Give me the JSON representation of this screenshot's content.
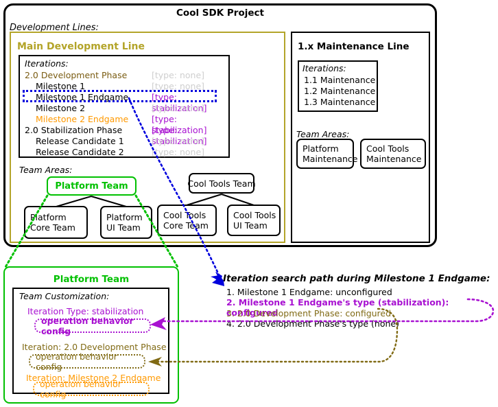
{
  "project": {
    "title": "Cool SDK Project",
    "dev_lines_label": "Development Lines:"
  },
  "main_dev_line": {
    "title": "Main Development Line",
    "iterations_label": "Iterations:",
    "iterations": [
      {
        "name": "2.0 Development Phase",
        "type": "[type: none]",
        "indent": 0,
        "name_color": "#7a5c12",
        "type_color": "#cfcfcf"
      },
      {
        "name": "Milestone 1",
        "type": "[type: none]",
        "indent": 1,
        "name_color": "#000000",
        "type_color": "#cfcfcf"
      },
      {
        "name": "Milestone 1 Endgame",
        "type": "[type: stabilization]",
        "indent": 1,
        "name_color": "#000000",
        "type_color": "#a811d1"
      },
      {
        "name": "Milestone 2",
        "type": "[type: none]",
        "indent": 1,
        "name_color": "#000000",
        "type_color": "#cfcfcf"
      },
      {
        "name": "Milestone 2 Endgame",
        "type": "[type: stabilization]",
        "indent": 1,
        "name_color": "#ff9900",
        "type_color": "#a811d1"
      },
      {
        "name": "2.0 Stabilization Phase",
        "type": "[type: stabilization]",
        "indent": 0,
        "name_color": "#000000",
        "type_color": "#a811d1"
      },
      {
        "name": "Release Candidate 1",
        "type": "[type: none]",
        "indent": 1,
        "name_color": "#000000",
        "type_color": "#cfcfcf"
      },
      {
        "name": "Release Candidate 2",
        "type": "[type: none]",
        "indent": 1,
        "name_color": "#000000",
        "type_color": "#cfcfcf"
      }
    ],
    "team_areas_label": "Team Areas:",
    "teams": {
      "platform_team": "Platform Team",
      "platform_core_team": "Platform\nCore Team",
      "platform_ui_team": "Platform\nUI Team",
      "cool_tools_team": "Cool Tools Team",
      "cool_tools_core_team": "Cool Tools\nCore Team",
      "cool_tools_ui_team": "Cool Tools\nUI Team"
    }
  },
  "maintenance_line": {
    "title": "1.x Maintenance Line",
    "iterations_label": "Iterations:",
    "iterations": [
      "1.1 Maintenance",
      "1.2 Maintenance",
      "1.3 Maintenance"
    ],
    "team_areas_label": "Team Areas:",
    "teams": {
      "platform_maintenance": "Platform\nMaintenance",
      "cool_tools_maintenance": "Cool Tools\nMaintenance"
    }
  },
  "platform_team_detail": {
    "title": "Platform Team",
    "customization_label": "Team Customization:",
    "entries": [
      {
        "label": "Iteration Type: stabilization",
        "pill": "operation behavior config",
        "color": "#a811d1"
      },
      {
        "label": "Iteration: 2.0 Development Phase",
        "pill": "operation behavior config",
        "color": "#806a14"
      },
      {
        "label": "Iteration: Milestone 2 Endgame",
        "pill": "operation behavior config",
        "color": "#ff9900"
      }
    ]
  },
  "search_path": {
    "title": "Iteration search path during Milestone 1 Endgame:",
    "items": [
      {
        "text": "1. Milestone 1 Endgame: unconfigured",
        "color": "#000000"
      },
      {
        "text": "2. Milestone 1 Endgame's type (stabilization): configured",
        "color": "#a811d1"
      },
      {
        "text": "3. 2.0 Development Phase: configured",
        "color": "#806a14"
      },
      {
        "text": "4. 2.0 Development Phase's type (none)",
        "color": "#000000"
      }
    ]
  },
  "colors": {
    "olive": "#b3a429",
    "green": "#00c000",
    "purple": "#a811d1",
    "orange": "#ff9900",
    "brown": "#806a14",
    "blue": "#0000dd",
    "gray": "#cfcfcf"
  }
}
